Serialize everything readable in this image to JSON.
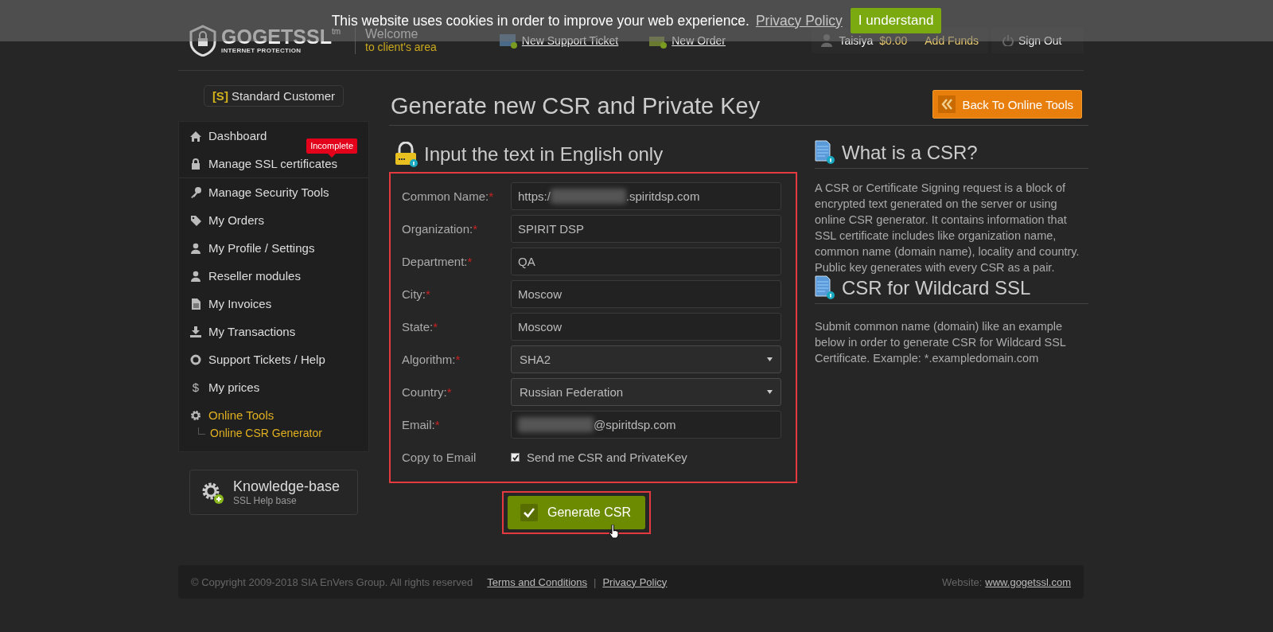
{
  "cookie_bar": {
    "message": "This website uses cookies in order to improve your web experience.",
    "link": "Privacy Policy",
    "button": "I understand"
  },
  "header": {
    "logo": "GOGETSSL",
    "logo_mark": "tm",
    "tagline": "INTERNET PROTECTION",
    "welcome": "Welcome",
    "welcome_sub": "to client's area",
    "links": [
      "New Support Ticket",
      "New Order"
    ],
    "user": "Taisiya",
    "balance": "$0.00",
    "add_funds": "Add Funds",
    "sign_out": "Sign Out"
  },
  "sidebar": {
    "customer_tag": "[S]",
    "customer_type": "Standard Customer",
    "items": [
      {
        "label": "Dashboard",
        "selected": false
      },
      {
        "label": "Manage SSL certificates",
        "selected": false,
        "badge": "Incomplete"
      },
      {
        "label": "Manage Security Tools",
        "selected": false
      },
      {
        "label": "My Orders",
        "selected": false
      },
      {
        "label": "My Profile / Settings",
        "selected": false
      },
      {
        "label": "Reseller modules",
        "selected": false
      },
      {
        "label": "My Invoices",
        "selected": false
      },
      {
        "label": "My Transactions",
        "selected": false
      },
      {
        "label": "Support Tickets / Help",
        "selected": false
      },
      {
        "label": "My prices",
        "selected": false,
        "icon_text": "$"
      },
      {
        "label": "Online Tools",
        "selected": true,
        "children": [
          {
            "label": "Online CSR Generator",
            "selected": true
          }
        ]
      }
    ],
    "knowledge": {
      "title": "Knowledge-base",
      "subtitle": "SSL Help base"
    }
  },
  "page": {
    "title": "Generate new CSR and Private Key",
    "back_button": "Back To Online Tools"
  },
  "form": {
    "heading": "Input the text in English only",
    "fields": [
      {
        "kind": "text",
        "label": "Common Name:",
        "required": true,
        "segments": [
          {
            "kind": "text",
            "text": "https:/"
          },
          {
            "kind": "redacted"
          },
          {
            "kind": "text",
            "text": ".spiritdsp.com"
          }
        ]
      },
      {
        "kind": "text",
        "label": "Organization:",
        "required": true,
        "value": "SPIRIT DSP"
      },
      {
        "kind": "text",
        "label": "Department:",
        "required": true,
        "value": "QA"
      },
      {
        "kind": "text",
        "label": "City:",
        "required": true,
        "value": "Moscow"
      },
      {
        "kind": "text",
        "label": "State:",
        "required": true,
        "value": "Moscow"
      },
      {
        "kind": "select",
        "label": "Algorithm:",
        "required": true,
        "value": "SHA2"
      },
      {
        "kind": "select",
        "label": "Country:",
        "required": true,
        "value": "Russian Federation"
      },
      {
        "kind": "text",
        "label": "Email:",
        "required": true,
        "segments": [
          {
            "kind": "redacted"
          },
          {
            "kind": "text",
            "text": "@spiritdsp.com"
          }
        ]
      },
      {
        "kind": "checkbox",
        "label": "Copy to Email",
        "required": false,
        "checked": true,
        "text": "Send me CSR and PrivateKey"
      }
    ],
    "required_mark": "*",
    "submit": "Generate CSR"
  },
  "info": [
    {
      "title": "What is a CSR?",
      "text": "A CSR or Certificate Signing request is a block of encrypted text generated on the server or using online CSR generator. It contains information that SSL certificate includes like organization name, common name (domain name), locality and country. Public key generates with every CSR as a pair."
    },
    {
      "title": "CSR for Wildcard SSL",
      "text": "Submit common name (domain) like an example below in order to generate CSR for Wildcard SSL Certificate. Example: *.exampledomain.com"
    }
  ],
  "footer": {
    "copyright": "© Copyright 2009-2018 SIA EnVers Group. All rights reserved",
    "links": [
      "Terms and Conditions",
      "Privacy Policy"
    ],
    "separator": "|",
    "website_label": "Website:",
    "website": "www.gogetssl.com"
  }
}
